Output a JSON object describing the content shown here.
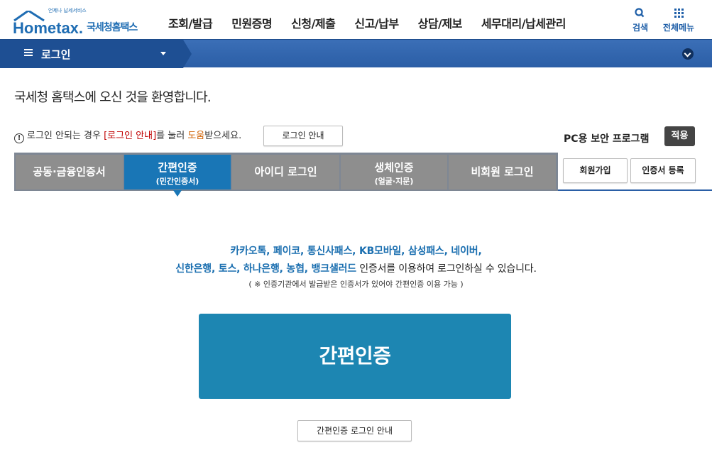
{
  "header": {
    "logo_sub": "언제나 납세서비스",
    "logo_main": "Hometax.",
    "logo_kr": "국세청홈택스",
    "nav": [
      "조회/발급",
      "민원증명",
      "신청/제출",
      "신고/납부",
      "상담/제보",
      "세무대리/납세관리"
    ],
    "search_label": "검색",
    "all_menu_label": "전체메뉴"
  },
  "bar": {
    "title": "로그인"
  },
  "welcome": "국세청 홈택스에 오신 것을 환영합니다.",
  "help": {
    "icon_text": "!",
    "text_1": "로그인 안되는 경우 ",
    "red_text": "[로그인 안내]",
    "text_2": "를 눌러 ",
    "orange_text": "도움",
    "text_3": "받으세요.",
    "button": "로그인 안내"
  },
  "security": {
    "label": "PC용 보안 프로그램",
    "apply": "적용"
  },
  "tabs": [
    {
      "label": "공동·금융인증서",
      "sub": ""
    },
    {
      "label": "간편인증",
      "sub": "(민간인증서)"
    },
    {
      "label": "아이디 로그인",
      "sub": ""
    },
    {
      "label": "생체인증",
      "sub": "(얼굴·지문)"
    },
    {
      "label": "비회원 로그인",
      "sub": ""
    }
  ],
  "side_buttons": {
    "join": "회원가입",
    "cert_register": "인증서 등록"
  },
  "content": {
    "line1_blue": "카카오톡, 페이코, 통신사패스, KB모바일, 삼성패스, 네이버,",
    "line2_blue": "신한은행, 토스, 하나은행, 농협, 뱅크샐러드",
    "line2_rest": " 인증서를 이용하여 로그인하실 수 있습니다.",
    "note": "( ※ 인증기관에서 발급받은 인증서가 있어야 간편인증 이용 가능 )",
    "main_button": "간편인증",
    "guide_button": "간편인증 로그인 안내"
  },
  "colors": {
    "brand_blue": "#1f6db3",
    "bar_blue": "#2b5ea6",
    "active_tab": "#1976b6",
    "inactive_tab": "#8e8e8e",
    "main_button": "#1d86b2"
  }
}
